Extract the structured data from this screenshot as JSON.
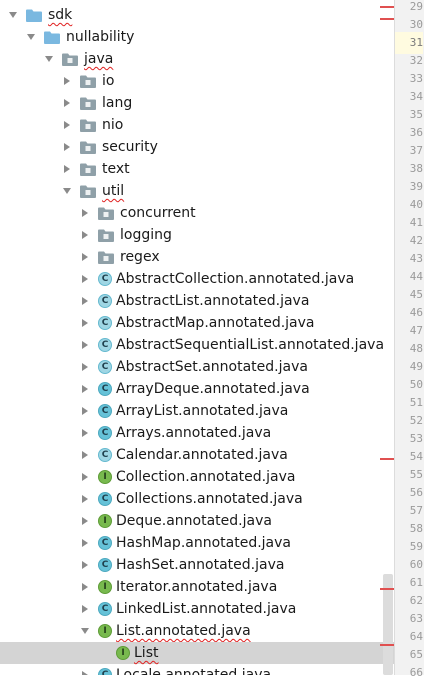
{
  "tree": [
    {
      "label": "sdk",
      "icon": "folder-icon",
      "arrow": "down",
      "level": 0,
      "squiggle": true
    },
    {
      "label": "nullability",
      "icon": "folder-icon",
      "arrow": "down",
      "level": 1,
      "squiggle": false
    },
    {
      "label": "java",
      "icon": "package-icon",
      "arrow": "down",
      "level": 2,
      "squiggle": true
    },
    {
      "label": "io",
      "icon": "package-icon",
      "arrow": "right",
      "level": 3
    },
    {
      "label": "lang",
      "icon": "package-icon",
      "arrow": "right",
      "level": 3
    },
    {
      "label": "nio",
      "icon": "package-icon",
      "arrow": "right",
      "level": 3
    },
    {
      "label": "security",
      "icon": "package-icon",
      "arrow": "right",
      "level": 3
    },
    {
      "label": "text",
      "icon": "package-icon",
      "arrow": "right",
      "level": 3
    },
    {
      "label": "util",
      "icon": "package-icon",
      "arrow": "down",
      "level": 3,
      "squiggle": true
    },
    {
      "label": "concurrent",
      "icon": "package-icon",
      "arrow": "right",
      "level": 4
    },
    {
      "label": "logging",
      "icon": "package-icon",
      "arrow": "right",
      "level": 4
    },
    {
      "label": "regex",
      "icon": "package-icon",
      "arrow": "right",
      "level": 4
    },
    {
      "label": "AbstractCollection.annotated.java",
      "icon": "abstract-class-icon",
      "glyph": "C",
      "arrow": "right",
      "level": 4
    },
    {
      "label": "AbstractList.annotated.java",
      "icon": "abstract-class-icon",
      "glyph": "C",
      "arrow": "right",
      "level": 4
    },
    {
      "label": "AbstractMap.annotated.java",
      "icon": "abstract-class-icon",
      "glyph": "C",
      "arrow": "right",
      "level": 4
    },
    {
      "label": "AbstractSequentialList.annotated.java",
      "icon": "abstract-class-icon",
      "glyph": "C",
      "arrow": "right",
      "level": 4
    },
    {
      "label": "AbstractSet.annotated.java",
      "icon": "abstract-class-icon",
      "glyph": "C",
      "arrow": "right",
      "level": 4
    },
    {
      "label": "ArrayDeque.annotated.java",
      "icon": "class-icon",
      "glyph": "C",
      "arrow": "right",
      "level": 4
    },
    {
      "label": "ArrayList.annotated.java",
      "icon": "class-icon",
      "glyph": "C",
      "arrow": "right",
      "level": 4
    },
    {
      "label": "Arrays.annotated.java",
      "icon": "class-icon",
      "glyph": "C",
      "arrow": "right",
      "level": 4
    },
    {
      "label": "Calendar.annotated.java",
      "icon": "abstract-class-icon",
      "glyph": "C",
      "arrow": "right",
      "level": 4
    },
    {
      "label": "Collection.annotated.java",
      "icon": "interface-icon",
      "glyph": "I",
      "arrow": "right",
      "level": 4
    },
    {
      "label": "Collections.annotated.java",
      "icon": "class-icon",
      "glyph": "C",
      "arrow": "right",
      "level": 4
    },
    {
      "label": "Deque.annotated.java",
      "icon": "interface-icon",
      "glyph": "I",
      "arrow": "right",
      "level": 4
    },
    {
      "label": "HashMap.annotated.java",
      "icon": "class-icon",
      "glyph": "C",
      "arrow": "right",
      "level": 4
    },
    {
      "label": "HashSet.annotated.java",
      "icon": "class-icon",
      "glyph": "C",
      "arrow": "right",
      "level": 4
    },
    {
      "label": "Iterator.annotated.java",
      "icon": "interface-icon",
      "glyph": "I",
      "arrow": "right",
      "level": 4
    },
    {
      "label": "LinkedList.annotated.java",
      "icon": "class-icon",
      "glyph": "C",
      "arrow": "right",
      "level": 4
    },
    {
      "label": "List.annotated.java",
      "icon": "interface-icon",
      "glyph": "I",
      "arrow": "down",
      "level": 4,
      "squiggle": true
    },
    {
      "label": "List",
      "icon": "interface-icon",
      "glyph": "I",
      "arrow": "none",
      "level": 5,
      "selected": true,
      "squiggle": true
    },
    {
      "label": "Locale.annotated.java",
      "icon": "class-icon",
      "glyph": "C",
      "arrow": "right",
      "level": 4
    }
  ],
  "gutter": {
    "lines": [
      "29",
      "30",
      "31",
      "32",
      "33",
      "34",
      "35",
      "36",
      "37",
      "38",
      "39",
      "40",
      "41",
      "42",
      "43",
      "44",
      "45",
      "46",
      "47",
      "48",
      "49",
      "50",
      "51",
      "52",
      "53",
      "54",
      "55",
      "56",
      "57",
      "58",
      "59",
      "60",
      "61",
      "62",
      "63",
      "64",
      "65",
      "66"
    ],
    "current": "31"
  },
  "colors": {
    "folder": "#7ab8e0",
    "package": "#8fa0a8",
    "selection": "#d4d4d4",
    "error": "#e05050",
    "class_icon": "#66c2d8",
    "interface_icon": "#78b94e"
  }
}
